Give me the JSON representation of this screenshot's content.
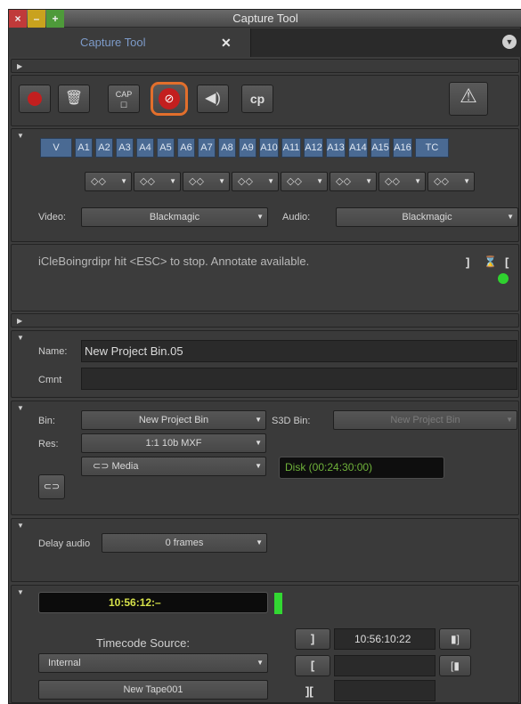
{
  "window": {
    "title": "Capture Tool"
  },
  "tab": {
    "label": "Capture Tool",
    "close": "✕"
  },
  "tracks": [
    "V",
    "A1",
    "A2",
    "A3",
    "A4",
    "A5",
    "A6",
    "A7",
    "A8",
    "A9",
    "A10",
    "A11",
    "A12",
    "A13",
    "A14",
    "A15",
    "A16",
    "TC"
  ],
  "channel_pairs": [
    "◇◇",
    "◇◇",
    "◇◇",
    "◇◇",
    "◇◇",
    "◇◇",
    "◇◇",
    "◇◇"
  ],
  "source": {
    "video_label": "Video:",
    "video_value": "Blackmagic",
    "audio_label": "Audio:",
    "audio_value": "Blackmagic"
  },
  "status": {
    "message": "iCleBoingrdipr hit <ESC> to stop. Annotate available.",
    "indicator_color": "#2fd12f"
  },
  "clip": {
    "name_label": "Name:",
    "name_value": "New Project Bin.05",
    "comment_label": "Cmnt"
  },
  "bin": {
    "bin_label": "Bin:",
    "bin_value": "New Project Bin",
    "s3d_label": "S3D Bin:",
    "s3d_value": "New Project Bin",
    "res_label": "Res:",
    "res_value": "1:1 10b MXF",
    "target_value": "Media",
    "disk_value": "Disk (00:24:30:00)"
  },
  "delay": {
    "label": "Delay audio",
    "value": "0 frames"
  },
  "timecode": {
    "readout": "10:56:12:–",
    "source_label": "Timecode Source:",
    "source_value": "Internal",
    "tape_value": "New Tape001",
    "mark_in_value": "10:56:10:22",
    "mark_out_value": "",
    "duration_value": ""
  }
}
